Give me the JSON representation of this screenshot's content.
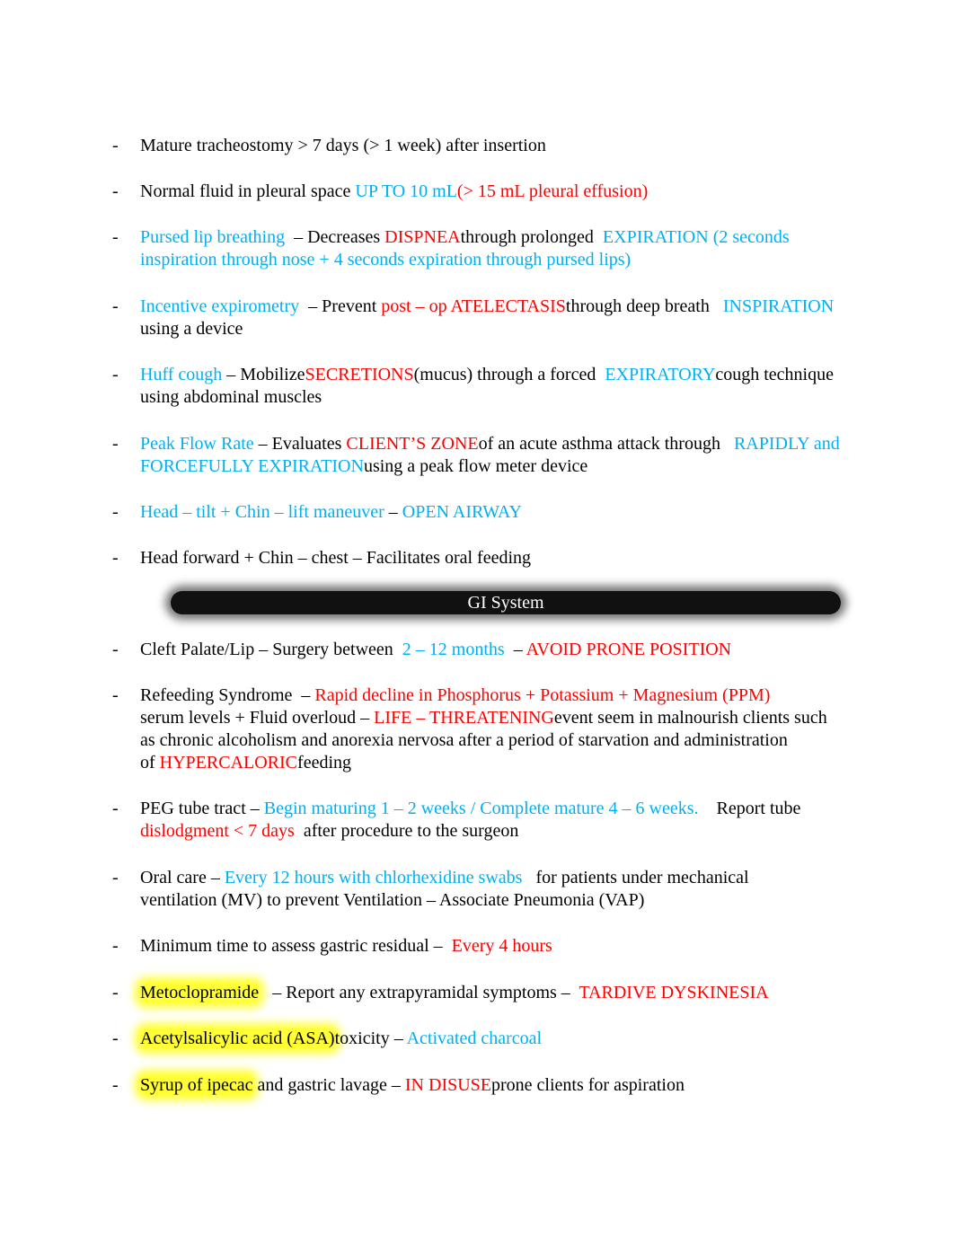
{
  "colors": {
    "black": "#000000",
    "blue": "#00b0f0",
    "red": "#ff0000",
    "highlight": "#ffff33"
  },
  "bullet": "-",
  "section_header": "GI System",
  "items": [
    {
      "lines": [
        [
          {
            "t": "Mature tracheostomy > 7 days (> 1 week) after insertion",
            "c": "k"
          }
        ]
      ]
    },
    {
      "lines": [
        [
          {
            "t": "Normal fluid in pleural space ",
            "c": "k"
          },
          {
            "t": "UP TO 10 mL",
            "c": "b"
          },
          {
            "t": "(> 15 mL pleural effusion)",
            "c": "r"
          }
        ]
      ]
    },
    {
      "lines": [
        [
          {
            "t": "Pursed lip breathing ",
            "c": "b"
          },
          {
            "t": " – Decreases ",
            "c": "k"
          },
          {
            "t": "DISPNEA",
            "c": "r"
          },
          {
            "t": "through prolonged  ",
            "c": "k"
          },
          {
            "t": "EXPIRATION (2 seconds",
            "c": "b"
          }
        ],
        [
          {
            "t": "inspiration through nose + 4 seconds expiration through pursed lips)",
            "c": "b"
          }
        ]
      ]
    },
    {
      "lines": [
        [
          {
            "t": "Incentive expirometry ",
            "c": "b"
          },
          {
            "t": " – Prevent ",
            "c": "k"
          },
          {
            "t": "post – op ATELECTASIS",
            "c": "r"
          },
          {
            "t": "through deep breath   ",
            "c": "k"
          },
          {
            "t": "INSPIRATION",
            "c": "b"
          }
        ],
        [
          {
            "t": "using a device",
            "c": "k"
          }
        ]
      ]
    },
    {
      "lines": [
        [
          {
            "t": "Huff cough",
            "c": "b"
          },
          {
            "t": " – Mobilize",
            "c": "k"
          },
          {
            "t": "SECRETIONS",
            "c": "r"
          },
          {
            "t": "(mucus) through a forced  ",
            "c": "k"
          },
          {
            "t": "EXPIRATORY",
            "c": "b"
          },
          {
            "t": "cough technique",
            "c": "k"
          }
        ],
        [
          {
            "t": "using abdominal muscles",
            "c": "k"
          }
        ]
      ]
    },
    {
      "lines": [
        [
          {
            "t": "Peak Flow Rate",
            "c": "b"
          },
          {
            "t": " – Evaluates ",
            "c": "k"
          },
          {
            "t": "CLIENT’S ZONE",
            "c": "r"
          },
          {
            "t": "of an acute asthma attack through   ",
            "c": "k"
          },
          {
            "t": "RAPIDLY and",
            "c": "b"
          }
        ],
        [
          {
            "t": "FORCEFULLY EXPIRATION",
            "c": "b"
          },
          {
            "t": "using a peak flow meter device",
            "c": "k"
          }
        ]
      ]
    },
    {
      "lines": [
        [
          {
            "t": "Head – tilt + Chin – lift maneuver",
            "c": "b"
          },
          {
            "t": " – ",
            "c": "k"
          },
          {
            "t": "OPEN AIRWAY",
            "c": "b"
          }
        ]
      ]
    },
    {
      "lines": [
        [
          {
            "t": "Head forward + Chin – chest – Facilitates oral feeding",
            "c": "k"
          }
        ]
      ]
    },
    {
      "lines": [
        [
          {
            "t": "Cleft Palate/Lip – Surgery between  ",
            "c": "k"
          },
          {
            "t": "2 – 12 months",
            "c": "b"
          },
          {
            "t": "  – ",
            "c": "k"
          },
          {
            "t": "AVOID PRONE POSITION",
            "c": "r"
          }
        ]
      ]
    },
    {
      "lines": [
        [
          {
            "t": "Refeeding Syndrome  – ",
            "c": "k"
          },
          {
            "t": "Rapid decline in Phosphorus + Potassium + Magnesium (PPM)",
            "c": "r"
          }
        ],
        [
          {
            "t": "serum levels + Fluid overloud – ",
            "c": "k"
          },
          {
            "t": "LIFE – THREATENING",
            "c": "r"
          },
          {
            "t": "event seem in malnourish clients such",
            "c": "k"
          }
        ],
        [
          {
            "t": "as chronic alcoholism and anorexia nervosa after a period of starvation and administration",
            "c": "k"
          }
        ],
        [
          {
            "t": "of ",
            "c": "k"
          },
          {
            "t": "HYPERCALORIC",
            "c": "r"
          },
          {
            "t": "feeding",
            "c": "k"
          }
        ]
      ]
    },
    {
      "lines": [
        [
          {
            "t": "PEG tube tract – ",
            "c": "k"
          },
          {
            "t": "Begin maturing 1 – 2 weeks / Complete mature 4 – 6 weeks.",
            "c": "b"
          },
          {
            "t": "    Report tube",
            "c": "k"
          }
        ],
        [
          {
            "t": "dislodgment < 7 days",
            "c": "r"
          },
          {
            "t": "  after procedure to the surgeon",
            "c": "k"
          }
        ]
      ]
    },
    {
      "lines": [
        [
          {
            "t": "Oral care – ",
            "c": "k"
          },
          {
            "t": "Every 12 hours with chlorhexidine swabs",
            "c": "b"
          },
          {
            "t": "   for patients under mechanical",
            "c": "k"
          }
        ],
        [
          {
            "t": "ventilation (MV) to prevent Ventilation – Associate Pneumonia (VAP)",
            "c": "k"
          }
        ]
      ]
    },
    {
      "lines": [
        [
          {
            "t": "Minimum time to assess gastric residual –  ",
            "c": "k"
          },
          {
            "t": "Every 4 hours",
            "c": "r"
          }
        ]
      ]
    },
    {
      "lines": [
        [
          {
            "t": "Metoclopramide",
            "c": "h"
          },
          {
            "t": "   – Report any extrapyramidal symptoms –  ",
            "c": "k"
          },
          {
            "t": "TARDIVE DYSKINESIA",
            "c": "r"
          }
        ]
      ]
    },
    {
      "lines": [
        [
          {
            "t": "Acetylsalicylic acid (ASA)",
            "c": "h"
          },
          {
            "t": "toxicity – ",
            "c": "k"
          },
          {
            "t": "Activated charcoal",
            "c": "b"
          }
        ]
      ]
    },
    {
      "lines": [
        [
          {
            "t": "Syrup of ipecac",
            "c": "h"
          },
          {
            "t": " and gastric lavage – ",
            "c": "k"
          },
          {
            "t": "IN DISUSE",
            "c": "r"
          },
          {
            "t": "prone clients for aspiration",
            "c": "k"
          }
        ]
      ]
    }
  ]
}
